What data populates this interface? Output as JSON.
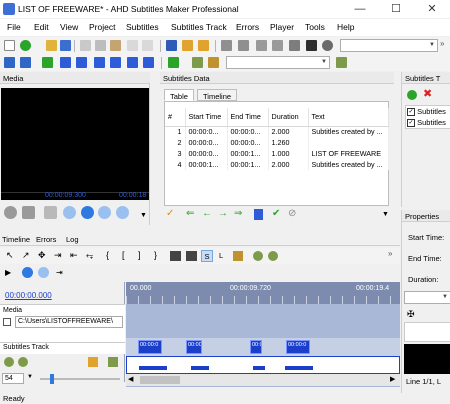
{
  "window": {
    "title": "LIST OF FREEWARE* - AHD Subtitles Maker Professional"
  },
  "menu": [
    "File",
    "Edit",
    "View",
    "Project",
    "Subtitles",
    "Subtitles Track",
    "Errors",
    "Player",
    "Tools",
    "Help"
  ],
  "panels": {
    "media": "Media",
    "subtitles_data": "Subtitles Data",
    "subtitles_tracks": "Subtitles T",
    "properties": "Properties"
  },
  "player": {
    "timecode": "00:00:09.300",
    "timecode_right": "00:00:18"
  },
  "subtitles_tabs": [
    "Table",
    "Timeline"
  ],
  "table": {
    "headers": [
      "#",
      "Start Time",
      "End Time",
      "Duration",
      "Text"
    ],
    "rows": [
      {
        "num": "1",
        "start": "00:00:0...",
        "end": "00:00:0...",
        "duration": "2.000",
        "text": "Subtitles created by ..."
      },
      {
        "num": "2",
        "start": "00:00:0...",
        "end": "00:00:0...",
        "duration": "1.260",
        "text": ""
      },
      {
        "num": "3",
        "start": "00:00:0...",
        "end": "00:00:1...",
        "duration": "1.000",
        "text": "LIST OF FREEWARE"
      },
      {
        "num": "4",
        "start": "00:00:1...",
        "end": "00:00:1...",
        "duration": "2.000",
        "text": "Subtitles created by ..."
      }
    ]
  },
  "tracks": {
    "items": [
      "Subtitles",
      "Subtitles"
    ]
  },
  "properties": {
    "start_label": "Start Time:",
    "end_label": "End Time:",
    "duration_label": "Duration:",
    "line_status": "Line 1/1, L"
  },
  "bottom_tabs": [
    "Timeline",
    "Errors",
    "Log"
  ],
  "timeline": {
    "current_time": "00:00:00.000",
    "ruler_start": "00.000",
    "ruler_mid": "00:00:09.720",
    "ruler_end": "00:00:19.4",
    "media_label": "Media",
    "media_path": "C:\\Users\\LISTOFFREEWARE\\",
    "subtitles_track_label": "Subtitles Track",
    "snap_letter": "S",
    "loop_letter": "L",
    "zoom_value": "54",
    "block_labels": [
      "00:00:0",
      "00:00:0",
      "00:0",
      "00:00:0"
    ]
  },
  "status": "Ready",
  "colors": {
    "accent": "#1c3fc9",
    "player_bg": "#000000",
    "timeline_bg": "#a9b8d6",
    "track_bg": "#c5d0e4"
  },
  "icons": [
    "app-icon",
    "new-icon",
    "open-icon",
    "save-icon",
    "play-icon",
    "stop-icon",
    "check-icon",
    "cancel-icon",
    "arrow-left-icon",
    "arrow-right-icon",
    "delete-icon",
    "add-icon"
  ]
}
